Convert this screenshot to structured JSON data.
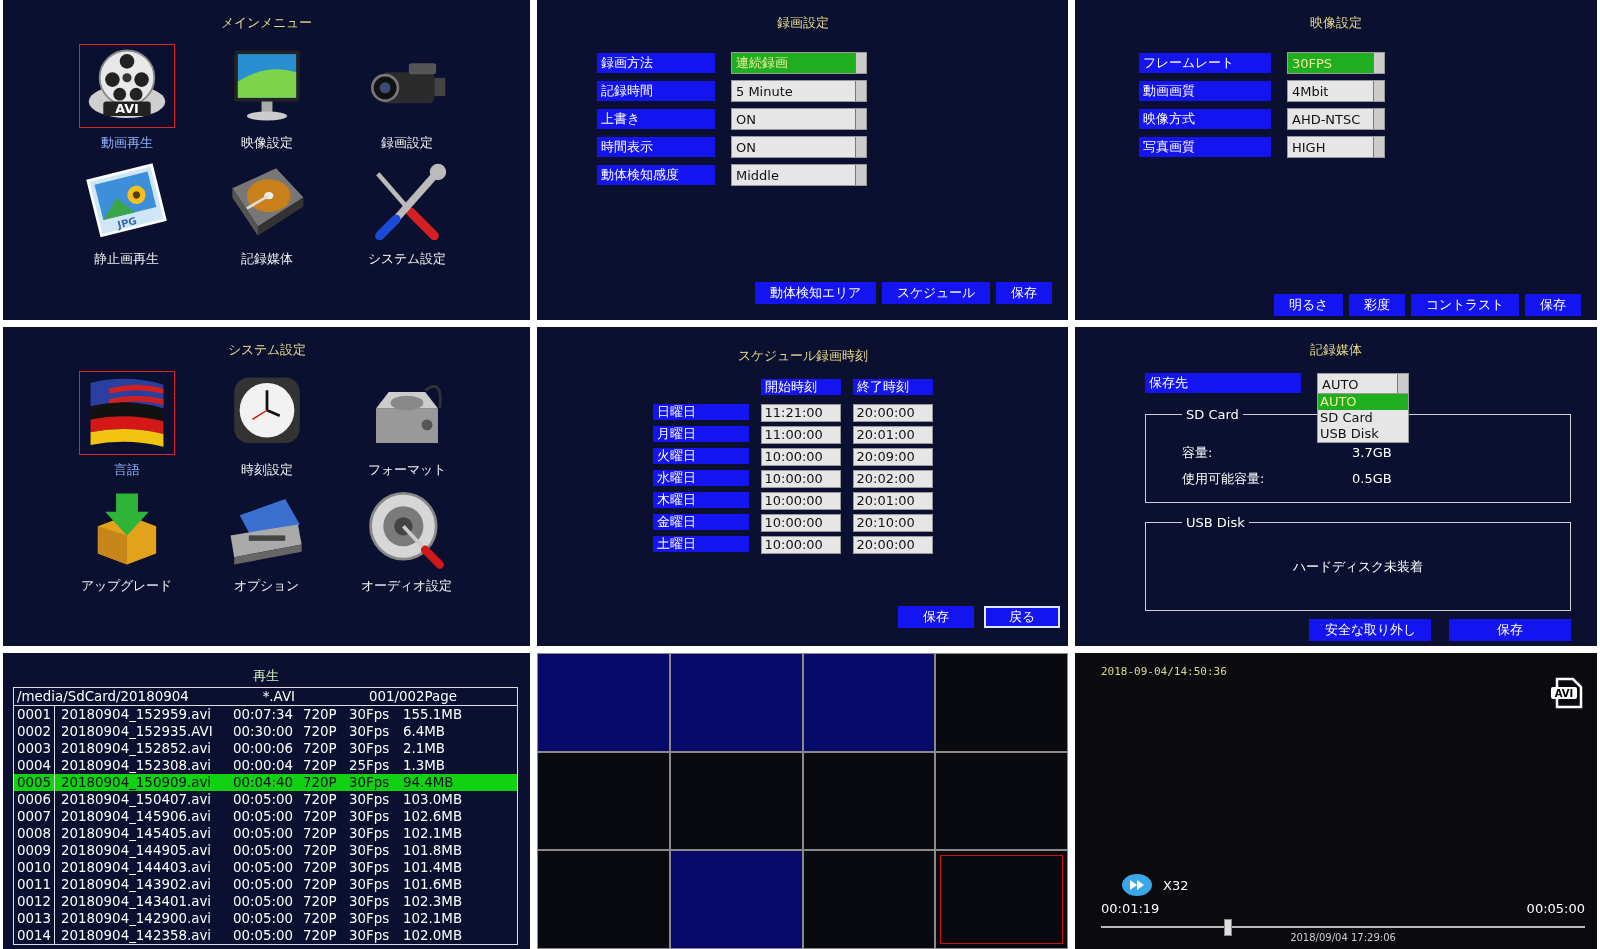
{
  "main_menu": {
    "title": "メインメニュー",
    "items": [
      {
        "label": "動画再生",
        "kind": "film",
        "icon_text": "AVI",
        "selected": true
      },
      {
        "label": "映像設定",
        "kind": "monitor",
        "selected": false
      },
      {
        "label": "録画設定",
        "kind": "camcorder",
        "selected": false
      },
      {
        "label": "静止画再生",
        "kind": "photo",
        "icon_text": "JPG",
        "selected": false
      },
      {
        "label": "記録媒体",
        "kind": "disk",
        "selected": false
      },
      {
        "label": "システム設定",
        "kind": "tools",
        "selected": false
      }
    ]
  },
  "record_settings": {
    "title": "録画設定",
    "fields": [
      {
        "label": "録画方法",
        "value": "連続録画",
        "selected": true
      },
      {
        "label": "記録時間",
        "value": "5 Minute",
        "selected": false
      },
      {
        "label": "上書き",
        "value": "ON",
        "selected": false
      },
      {
        "label": "時間表示",
        "value": "ON",
        "selected": false
      },
      {
        "label": "動体検知感度",
        "value": "Middle",
        "selected": false
      }
    ],
    "buttons": [
      "動体検知エリア",
      "スケジュール",
      "保存"
    ]
  },
  "video_settings": {
    "title": "映像設定",
    "fields": [
      {
        "label": "フレームレート",
        "value": "30FPS",
        "selected": true
      },
      {
        "label": "動画画質",
        "value": "4Mbit",
        "selected": false
      },
      {
        "label": "映像方式",
        "value": "AHD-NTSC",
        "selected": false
      },
      {
        "label": "写真画質",
        "value": "HIGH",
        "selected": false
      }
    ],
    "buttons": [
      "明るさ",
      "彩度",
      "コントラスト",
      "保存"
    ]
  },
  "system_settings": {
    "title": "システム設定",
    "items": [
      {
        "label": "言語",
        "kind": "flag",
        "selected": true
      },
      {
        "label": "時刻設定",
        "kind": "clock",
        "selected": false
      },
      {
        "label": "フォーマット",
        "kind": "drive",
        "selected": false
      },
      {
        "label": "アップグレード",
        "kind": "box",
        "selected": false
      },
      {
        "label": "オプション",
        "kind": "toolbox",
        "selected": false
      },
      {
        "label": "オーディオ設定",
        "kind": "speaker",
        "selected": false
      }
    ]
  },
  "schedule": {
    "title": "スケジュール録画時刻",
    "columns": [
      "開始時刻",
      "終了時刻"
    ],
    "rows": [
      {
        "day": "日曜日",
        "start": "11:21:00",
        "end": "20:00:00"
      },
      {
        "day": "月曜日",
        "start": "11:00:00",
        "end": "20:01:00"
      },
      {
        "day": "火曜日",
        "start": "10:00:00",
        "end": "20:09:00"
      },
      {
        "day": "水曜日",
        "start": "10:00:00",
        "end": "20:02:00"
      },
      {
        "day": "木曜日",
        "start": "10:00:00",
        "end": "20:01:00"
      },
      {
        "day": "金曜日",
        "start": "10:00:00",
        "end": "20:10:00"
      },
      {
        "day": "土曜日",
        "start": "10:00:00",
        "end": "20:00:00"
      }
    ],
    "buttons": [
      {
        "label": "保存",
        "selected": false
      },
      {
        "label": "戻る",
        "selected": true
      }
    ]
  },
  "storage": {
    "title": "記録媒体",
    "destination": {
      "label": "保存先",
      "value": "AUTO",
      "options": [
        {
          "label": "AUTO",
          "selected": true
        },
        {
          "label": "SD Card",
          "selected": false
        },
        {
          "label": "USB Disk",
          "selected": false
        }
      ]
    },
    "sd_card": {
      "title": "SD Card",
      "rows": [
        {
          "label": "容量:",
          "value": "3.7GB"
        },
        {
          "label": "使用可能容量:",
          "value": "0.5GB"
        }
      ]
    },
    "usb_disk": {
      "title": "USB Disk",
      "message": "ハードディスク未装着"
    },
    "buttons": [
      "安全な取り外し",
      "保存"
    ]
  },
  "playback": {
    "title": "再生",
    "path": "/media/SdCard/20180904",
    "filter": "*.AVI",
    "page": "001/002Page",
    "rows": [
      {
        "index": "0001",
        "file": "20180904_152959.avi",
        "duration": "00:07:34",
        "resolution": "720P",
        "fps": "30Fps",
        "size": "155.1MB",
        "selected": false
      },
      {
        "index": "0002",
        "file": "20180904_152935.AVI",
        "duration": "00:30:00",
        "resolution": "720P",
        "fps": "30Fps",
        "size": "6.4MB",
        "selected": false
      },
      {
        "index": "0003",
        "file": "20180904_152852.avi",
        "duration": "00:00:06",
        "resolution": "720P",
        "fps": "30Fps",
        "size": "2.1MB",
        "selected": false
      },
      {
        "index": "0004",
        "file": "20180904_152308.avi",
        "duration": "00:00:04",
        "resolution": "720P",
        "fps": "25Fps",
        "size": "1.3MB",
        "selected": false
      },
      {
        "index": "0005",
        "file": "20180904_150909.avi",
        "duration": "00:04:40",
        "resolution": "720P",
        "fps": "30Fps",
        "size": "94.4MB",
        "selected": true
      },
      {
        "index": "0006",
        "file": "20180904_150407.avi",
        "duration": "00:05:00",
        "resolution": "720P",
        "fps": "30Fps",
        "size": "103.0MB",
        "selected": false
      },
      {
        "index": "0007",
        "file": "20180904_145906.avi",
        "duration": "00:05:00",
        "resolution": "720P",
        "fps": "30Fps",
        "size": "102.6MB",
        "selected": false
      },
      {
        "index": "0008",
        "file": "20180904_145405.avi",
        "duration": "00:05:00",
        "resolution": "720P",
        "fps": "30Fps",
        "size": "102.1MB",
        "selected": false
      },
      {
        "index": "0009",
        "file": "20180904_144905.avi",
        "duration": "00:05:00",
        "resolution": "720P",
        "fps": "30Fps",
        "size": "101.8MB",
        "selected": false
      },
      {
        "index": "0010",
        "file": "20180904_144403.avi",
        "duration": "00:05:00",
        "resolution": "720P",
        "fps": "30Fps",
        "size": "101.4MB",
        "selected": false
      },
      {
        "index": "0011",
        "file": "20180904_143902.avi",
        "duration": "00:05:00",
        "resolution": "720P",
        "fps": "30Fps",
        "size": "101.6MB",
        "selected": false
      },
      {
        "index": "0012",
        "file": "20180904_143401.avi",
        "duration": "00:05:00",
        "resolution": "720P",
        "fps": "30Fps",
        "size": "102.3MB",
        "selected": false
      },
      {
        "index": "0013",
        "file": "20180904_142900.avi",
        "duration": "00:05:00",
        "resolution": "720P",
        "fps": "30Fps",
        "size": "102.1MB",
        "selected": false
      },
      {
        "index": "0014",
        "file": "20180904_142358.avi",
        "duration": "00:05:00",
        "resolution": "720P",
        "fps": "30Fps",
        "size": "102.0MB",
        "selected": false
      }
    ]
  },
  "camera_grid": {
    "cells": [
      {
        "filled": true,
        "selected": false
      },
      {
        "filled": true,
        "selected": false
      },
      {
        "filled": true,
        "selected": false
      },
      {
        "filled": false,
        "selected": false
      },
      {
        "filled": false,
        "selected": false
      },
      {
        "filled": false,
        "selected": false
      },
      {
        "filled": false,
        "selected": false
      },
      {
        "filled": false,
        "selected": false
      },
      {
        "filled": false,
        "selected": false
      },
      {
        "filled": true,
        "selected": false
      },
      {
        "filled": false,
        "selected": false
      },
      {
        "filled": false,
        "selected": true
      }
    ]
  },
  "player": {
    "timestamp": "2018-09-04/14:50:36",
    "file_badge": "AVI",
    "speed": "X32",
    "elapsed": "00:01:19",
    "total": "00:05:00",
    "progress": {
      "level": 0.26
    },
    "date_label": "2018/09/04 17:29:06"
  }
}
